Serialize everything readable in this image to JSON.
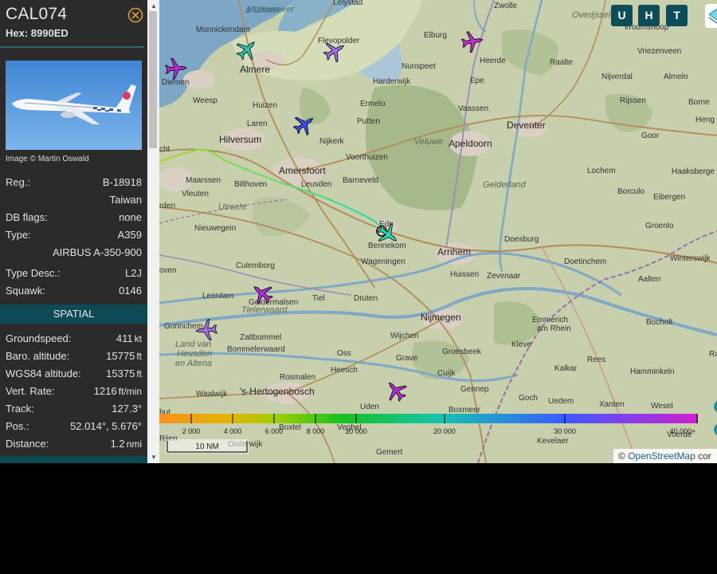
{
  "sidebar": {
    "callsign": "CAL074",
    "hex_line": "Hex: 8990ED",
    "photo_credit": "Image © Martin Oswald",
    "rows": [
      {
        "label": "Reg.:",
        "value": "B-18918"
      },
      {
        "label": "",
        "value": "Taiwan"
      },
      {
        "label": "DB flags:",
        "value": "none"
      },
      {
        "label": "Type:",
        "value": "A359"
      },
      {
        "label": "",
        "value": "AIRBUS A-350-900"
      },
      {
        "label": "Type Desc.:",
        "value": "L2J"
      },
      {
        "label": "Squawk:",
        "value": "0146"
      }
    ],
    "spatial_title": "SPATIAL",
    "spatial_rows": [
      {
        "label": "Groundspeed:",
        "value": "411",
        "unit": "kt"
      },
      {
        "label": "Baro. altitude:",
        "value": "15775",
        "unit": "ft"
      },
      {
        "label": "WGS84 altitude:",
        "value": "15375",
        "unit": "ft"
      },
      {
        "label": "Vert. Rate:",
        "value": "1216",
        "unit": "ft/min"
      },
      {
        "label": "Track:",
        "value": "127.3°",
        "unit": ""
      },
      {
        "label": "Pos.:",
        "value": "52.014°, 5.676°",
        "unit": ""
      },
      {
        "label": "Distance:",
        "value": "1.2",
        "unit": "nmi"
      }
    ]
  },
  "map": {
    "buttons": [
      "U",
      "H",
      "T"
    ],
    "scale_label": "10 NM",
    "attribution_prefix": "©",
    "attribution_link": "OpenStreetMap",
    "attribution_suffix": "cor",
    "legend_ticks": [
      "2 000",
      "4 000",
      "6 000",
      "8 000",
      "10 000",
      "20 000",
      "30 000",
      "40 000+"
    ],
    "places": {
      "towns": [
        "Monnickendam",
        "Lelystad",
        "Zwolle",
        "Overijssel",
        "Vroomshoop",
        "Almere",
        "Flevopolder",
        "Elburg",
        "Heerde",
        "Raalte",
        "Vriezenveen",
        "Diemen",
        "Weesp",
        "Harderwijk",
        "Nunspeet",
        "Epe",
        "Nijverdal",
        "Almelo",
        "Huizen",
        "Ermelo",
        "Vaassen",
        "Rijssen",
        "Borne",
        "Heng",
        "Laren",
        "Putten",
        "Hilversum",
        "Nijkerk",
        "Goor",
        "cht",
        "Voorthuizen",
        "Maarssen",
        "Bilthoven",
        "Leusden",
        "Barneveld",
        "Lochem",
        "Haaksberge",
        "Vleuten",
        "Borculo",
        "Eibergen",
        "rden",
        "Ede",
        "Bennekom",
        "Groenlo",
        "Nieuwegein",
        "Doesburg",
        "Wageningen",
        "Doetinchem",
        "Winterswijk",
        "oven",
        "Culemborg",
        "Huissen",
        "Zevenaar",
        "Aalten",
        "Leerdam",
        "Geldermalsen",
        "Tiel",
        "Druten",
        "Tielerwaard",
        "Emmerich am Rhein",
        "Bocholt",
        "Gorinchem",
        "Zaltbommel",
        "Wijchen",
        "Bommelerwaard",
        "Kleve",
        "Rees",
        "Land van Heusden en Altena",
        "Oss",
        "Grave",
        "Groesbeek",
        "Ra",
        "Heesch",
        "Cuijk",
        "Kalkar",
        "Hamminkeln",
        "Rosmalen",
        "Gennep",
        "Waalwijk",
        "Uden",
        "Goch",
        "Uedem",
        "Xanten",
        "Wesel",
        "but",
        "Boxmeer",
        "Voerde",
        "Boxtel",
        "Veghel",
        "Rijen",
        "Oisterwijk",
        "Gemert",
        "Kevelaer"
      ],
      "cities": [
        "Amersfoort",
        "Apeldoorn",
        "Deventer",
        "Arnhem",
        "Nijmegen",
        "'s-Hertogenbosch"
      ],
      "regions": [
        "Utrecht",
        "Veluwe",
        "Gelderland"
      ],
      "water": [
        "Markermeer & IJmeer"
      ]
    }
  },
  "colors": {
    "sidebar_bg": "#2b2b2b",
    "section_header": "#0c4a55",
    "map_button": "#0d4d58",
    "selected_aircraft": "#2ad9b4"
  }
}
